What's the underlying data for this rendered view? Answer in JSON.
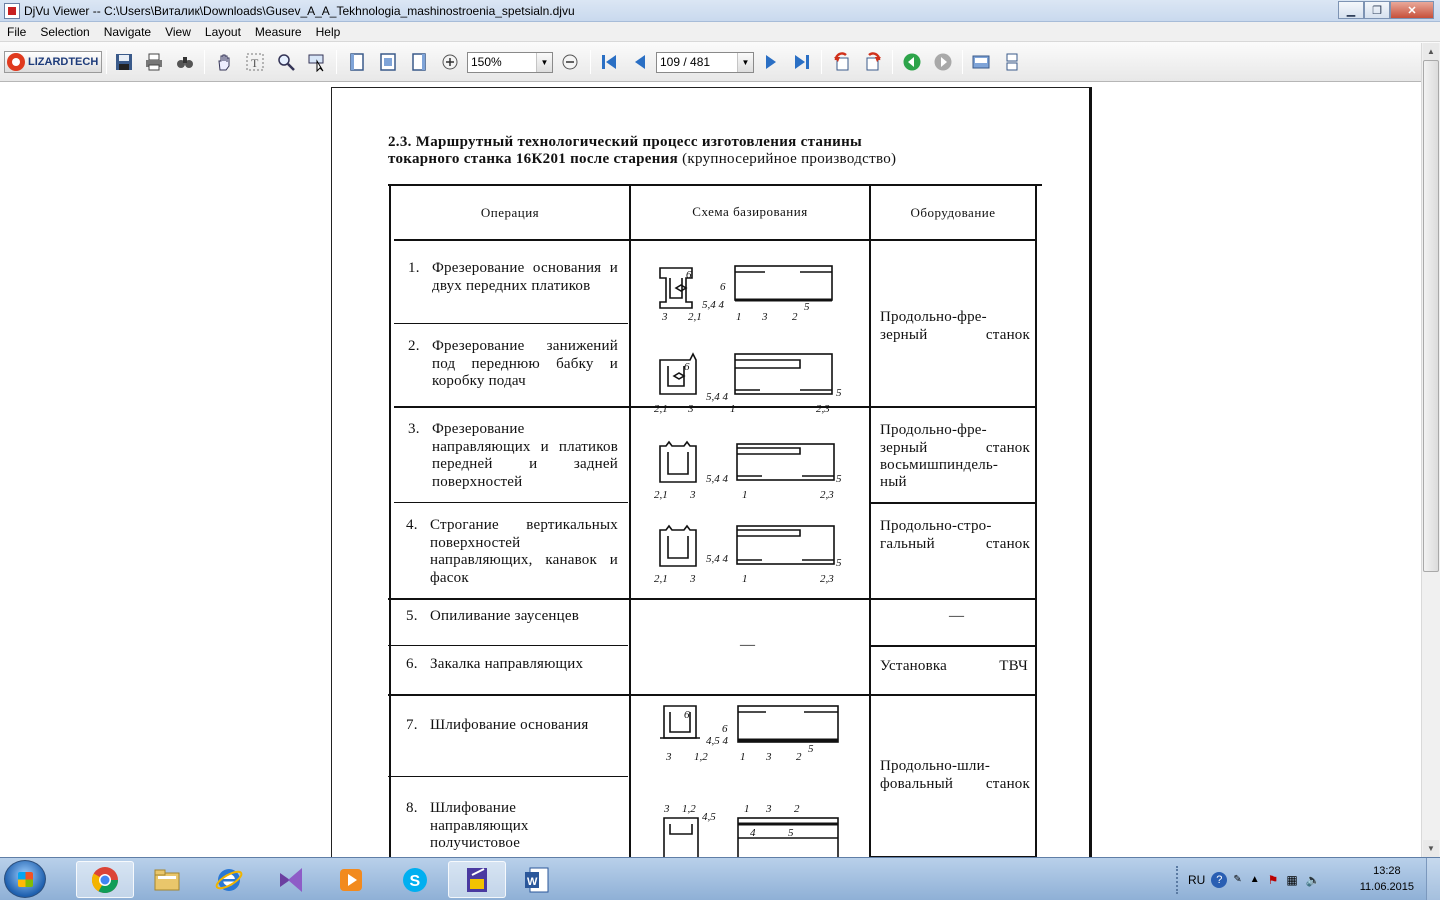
{
  "window": {
    "title": "DjVu Viewer -- C:\\Users\\Виталик\\Downloads\\Gusev_A_A_Tekhnologia_mashinostroenia_spetsialn.djvu",
    "minimize": "▁",
    "maximize": "❐",
    "close": "✕"
  },
  "menu": [
    "File",
    "Selection",
    "Navigate",
    "View",
    "Layout",
    "Measure",
    "Help"
  ],
  "toolbar": {
    "logo_text": "LIZARDTECH",
    "zoom_value": "150%",
    "page_value": "109 / 481"
  },
  "document": {
    "heading_line1": "2.3. Маршрутный технологический процесс изготовления станины",
    "heading_line2_bold": "токарного станка 16К201 после старения",
    "heading_line2_normal": " (крупносерийное производство)",
    "table": {
      "headers": [
        "Операция",
        "Схема базирования",
        "Оборудование"
      ],
      "operations": [
        {
          "num": "1.",
          "text": "Фрезерование основания и двух передних платиков"
        },
        {
          "num": "2.",
          "text": "Фрезерование занижений под переднюю бабку и коробку подач"
        },
        {
          "num": "3.",
          "text": "Фрезерование направляющих и платиков передней и задней поверхностей"
        },
        {
          "num": "4.",
          "text": "Строгание вертикальных поверхностей направляющих, канавок и фасок"
        },
        {
          "num": "5.",
          "text": "Опиливание заусенцев"
        },
        {
          "num": "6.",
          "text": "Закалка направляющих"
        },
        {
          "num": "7.",
          "text": "Шлифование основания"
        },
        {
          "num": "8.",
          "text": "Шлифование направляющих получистовое"
        }
      ],
      "equipment": [
        {
          "line1": "Продольно-фре-",
          "line2": "зерный станок"
        },
        {
          "line1": "Продольно-фре-",
          "line2": "зерный станок",
          "line3": "восьмишпиндель-",
          "line4": "ный"
        },
        {
          "line1": "Продольно-стро-",
          "line2": "гальный станок"
        },
        {
          "line1": "—"
        },
        {
          "line1": "Установка ТВЧ"
        },
        {
          "line1": "Продольно-шли-",
          "line2": "фовальный станок"
        }
      ],
      "scheme_dash": "—",
      "scheme_labels": {
        "s1": {
          "top": "6",
          "side": "6",
          "mid": "5,4 4",
          "bl": "3",
          "bm": "2,1",
          "b1": "1",
          "b2": "3",
          "b3": "2",
          "br": "5"
        },
        "s2": {
          "top": "6",
          "mid": "5,4 4",
          "bl": "2,1",
          "bm": "3",
          "b1": "1",
          "b3": "2,3",
          "br": "5"
        },
        "s3": {
          "mid": "5,4 4",
          "bl": "2,1",
          "bm": "3",
          "b1": "1",
          "b3": "2,3",
          "br": "5"
        },
        "s4": {
          "mid": "5,4 4",
          "bl": "2,1",
          "bm": "3",
          "b1": "1",
          "b3": "2,3",
          "br": "5"
        },
        "s7": {
          "top": "6",
          "side": "6",
          "mid": "4,5 4",
          "bl": "3",
          "bm": "1,2",
          "b1": "1",
          "b2": "3",
          "b3": "2",
          "br": "5"
        },
        "s8": {
          "tl": "3",
          "tm": "1,2",
          "tr": "4,5",
          "t1": "1",
          "t2": "3",
          "t3": "2",
          "m1": "4",
          "m2": "5"
        }
      }
    }
  },
  "taskbar": {
    "lang": "RU",
    "time": "13:28",
    "date": "11.06.2015"
  }
}
